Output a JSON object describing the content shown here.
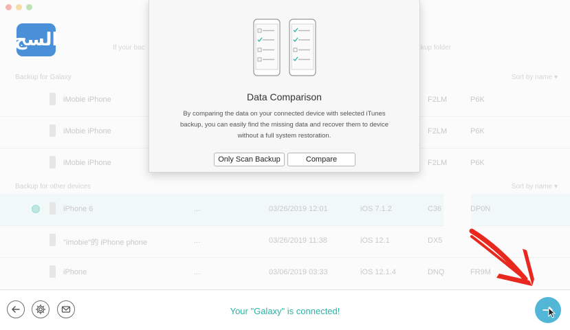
{
  "hints": {
    "left": "If your bac",
    "right": "ckup folder"
  },
  "sections": [
    {
      "label": "Backup for Galaxy",
      "sort_label": "Sort by name"
    },
    {
      "label": "Backup for other devices",
      "sort_label": "Sort by name"
    }
  ],
  "galaxy_rows": [
    {
      "name": "iMobie iPhone",
      "sn1": "F2LM",
      "sn2": "P6K"
    },
    {
      "name": "iMobie iPhone",
      "sn1": "F2LM",
      "sn2": "P6K"
    },
    {
      "name": "iMobie iPhone",
      "sn1": "F2LM",
      "sn2": "P6K"
    }
  ],
  "other_rows": [
    {
      "name": "iPhone 6",
      "dots": "...",
      "date": "03/26/2019 12:01",
      "ios": "iOS 7.1.2",
      "sn1": "C36",
      "sn2": "DP0N",
      "selected": true
    },
    {
      "name": "\"imobie\"的 iPhone phone",
      "dots": "...",
      "date": "03/26/2019 11:38",
      "ios": "iOS 12.1",
      "sn1": "DX5",
      "sn2": "",
      "selected": false
    },
    {
      "name": "iPhone",
      "dots": "...",
      "date": "03/06/2019 03:33",
      "ios": "iOS 12.1.4",
      "sn1": "DNQ",
      "sn2": "FR9M",
      "selected": false
    }
  ],
  "dialog": {
    "title": "Data Comparison",
    "description": "By comparing the data on your connected device with selected iTunes backup, you can easily find the missing data and recover them to device without a full system restoration.",
    "btn_scan": "Only Scan Backup",
    "btn_compare": "Compare"
  },
  "footer": {
    "status": "Your \"Galaxy\" is connected!"
  },
  "logo_text": "السج",
  "colors": {
    "accent_teal": "#2bb3a5",
    "go_button": "#52b7d6",
    "logo_bg": "#4a90d9",
    "arrow_red": "#e8281e"
  }
}
